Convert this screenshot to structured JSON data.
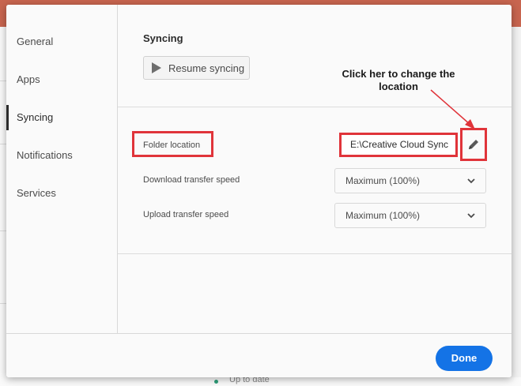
{
  "sidebar": {
    "items": [
      {
        "label": "General"
      },
      {
        "label": "Apps"
      },
      {
        "label": "Syncing",
        "active": true
      },
      {
        "label": "Notifications"
      },
      {
        "label": "Services"
      }
    ]
  },
  "syncing": {
    "title": "Syncing",
    "resume_button": "Resume syncing",
    "folder_location_label": "Folder location",
    "folder_location_value": "E:\\Creative Cloud Sync",
    "download_speed_label": "Download transfer speed",
    "download_speed_value": "Maximum (100%)",
    "upload_speed_label": "Upload transfer speed",
    "upload_speed_value": "Maximum (100%)"
  },
  "annotation": {
    "line1": "Click her to change the",
    "line2": "location",
    "color": "#e0343a"
  },
  "footer": {
    "done_button": "Done"
  },
  "colors": {
    "accent": "#1473e6",
    "highlight": "#e0343a",
    "app_header": "#c8654f"
  },
  "background": {
    "partial_text": "Up to date"
  }
}
